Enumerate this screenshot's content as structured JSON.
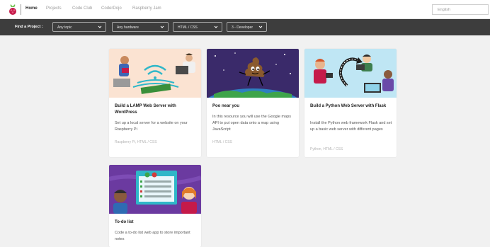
{
  "nav": {
    "items": [
      {
        "label": "Home",
        "active": true
      },
      {
        "label": "Projects"
      },
      {
        "label": "Code Club"
      },
      {
        "label": "CoderDojo"
      },
      {
        "label": "Raspberry Jam"
      }
    ],
    "language": "English"
  },
  "filters": {
    "label": "Find a Project :",
    "dropdowns": [
      {
        "value": "Any topic"
      },
      {
        "value": "Any hardware"
      },
      {
        "value": "HTML / CSS"
      },
      {
        "value": "3 - Developer"
      }
    ]
  },
  "colors": {
    "filterbar_bg": "#3d3d3d",
    "page_bg": "#f1f1f1",
    "raspberry": "#c51a4a"
  },
  "cards": [
    {
      "title": "Build a LAMP Web Server with WordPress",
      "description": "Set up a local server for a website on your Raspberry Pi",
      "meta": "Raspberry Pi, HTML / CSS",
      "image": "lamp-server-illustration"
    },
    {
      "title": "Poo near you",
      "description": "In this resource you will use the Google maps API to put open data onto a map using JavaScript",
      "meta": "HTML / CSS",
      "image": "poo-emoji-space-illustration"
    },
    {
      "title": "Build a Python Web Server with Flask",
      "description": "Install the Python web framework Flask and set up a basic web server with different pages",
      "meta": "Python, HTML / CSS",
      "image": "flask-server-illustration"
    },
    {
      "title": "To-do list",
      "description": "Code a to-do list web app to store important notes",
      "meta": "",
      "image": "todo-list-illustration"
    }
  ]
}
